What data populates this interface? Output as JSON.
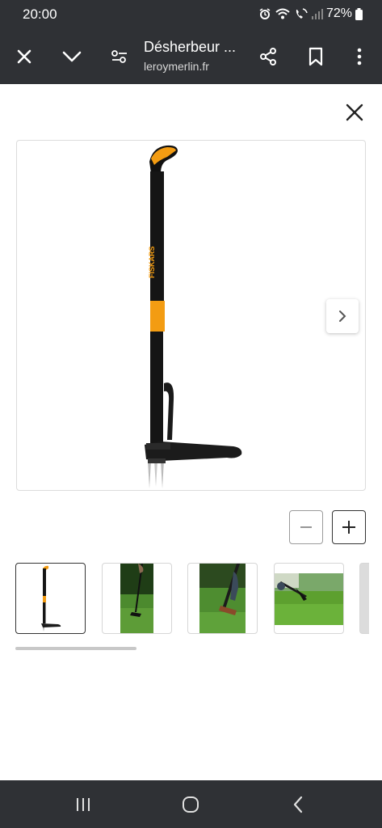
{
  "status_bar": {
    "time": "20:00",
    "battery": "72%"
  },
  "toolbar": {
    "title": "Désherbeur ...",
    "url": "leroymerlin.fr"
  },
  "product_image": {
    "brand_text": "FISKARS"
  },
  "thumbnails": [
    {
      "icon": "weeder-product-thumb",
      "selected": true
    },
    {
      "icon": "weeder-in-use-grass-thumb",
      "selected": false
    },
    {
      "icon": "weeder-foot-press-thumb",
      "selected": false
    },
    {
      "icon": "weeder-garden-scene-thumb",
      "selected": false
    }
  ],
  "colors": {
    "bar_background": "#2f3135",
    "accent_orange": "#f39c12"
  }
}
